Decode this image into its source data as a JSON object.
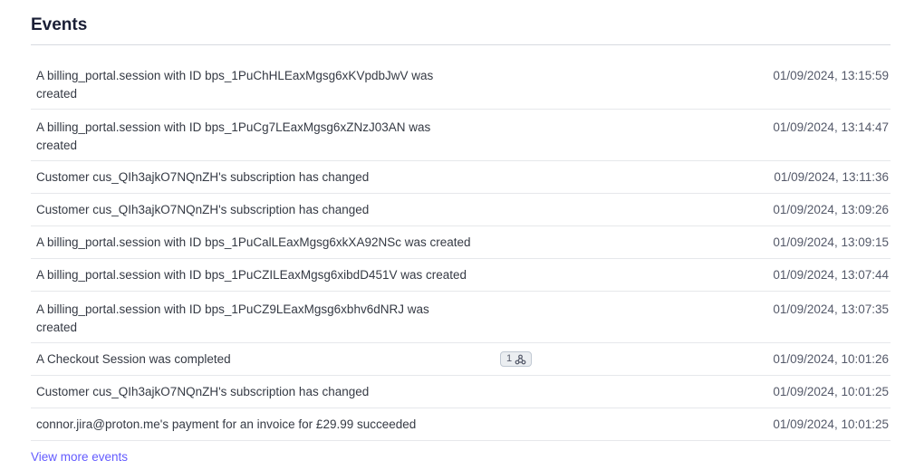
{
  "section": {
    "title": "Events",
    "view_more_label": "View more events"
  },
  "events": [
    {
      "description": "A billing_portal.session with ID bps_1PuChHLEaxMgsg6xKVpdbJwV was created",
      "timestamp": "01/09/2024, 13:15:59"
    },
    {
      "description": "A billing_portal.session with ID bps_1PuCg7LEaxMgsg6xZNzJ03AN was created",
      "timestamp": "01/09/2024, 13:14:47"
    },
    {
      "description": "Customer cus_QIh3ajkO7NQnZH's subscription has changed",
      "timestamp": "01/09/2024, 13:11:36"
    },
    {
      "description": "Customer cus_QIh3ajkO7NQnZH's subscription has changed",
      "timestamp": "01/09/2024, 13:09:26"
    },
    {
      "description": "A billing_portal.session with ID bps_1PuCalLEaxMgsg6xkXA92NSc was created",
      "timestamp": "01/09/2024, 13:09:15"
    },
    {
      "description": "A billing_portal.session with ID bps_1PuCZILEaxMgsg6xibdD451V was created",
      "timestamp": "01/09/2024, 13:07:44"
    },
    {
      "description": "A billing_portal.session with ID bps_1PuCZ9LEaxMgsg6xbhv6dNRJ was created",
      "timestamp": "01/09/2024, 13:07:35"
    },
    {
      "description": "A Checkout Session was completed",
      "timestamp": "01/09/2024, 10:01:26",
      "badge": {
        "count": "1",
        "icon": "webhook-icon"
      }
    },
    {
      "description": "Customer cus_QIh3ajkO7NQnZH's subscription has changed",
      "timestamp": "01/09/2024, 10:01:25"
    },
    {
      "description": "connor.jira@proton.me's payment for an invoice for £29.99 succeeded",
      "timestamp": "01/09/2024, 10:01:25"
    }
  ],
  "colors": {
    "link": "#635bff",
    "title": "#1a1f36",
    "text": "#353a44",
    "muted": "#545969",
    "divider": "#e6e8eb"
  }
}
